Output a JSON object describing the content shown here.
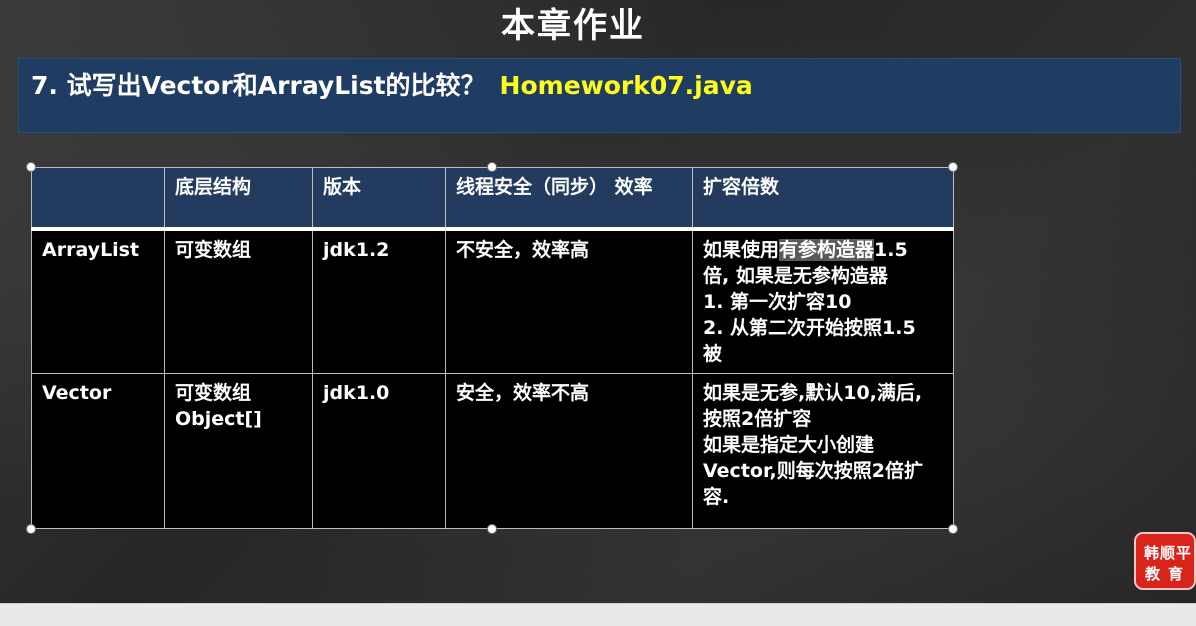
{
  "chapter_title": "本章作业",
  "question": {
    "text": "7. 试写出Vector和ArrayList的比较？",
    "file": "Homework07.java"
  },
  "table": {
    "headers": [
      "",
      "底层结构",
      "版本",
      "线程安全（同步） 效率",
      "扩容倍数"
    ],
    "rows": [
      {
        "name": "ArrayList",
        "structure": [
          "可变数组"
        ],
        "version": "jdk1.2",
        "safety": "不安全，效率高",
        "growth_prefix": "如果使用",
        "growth_highlight": "有参构造器",
        "growth_rest": [
          "1.5",
          "倍, 如果是无参构造器",
          "1. 第一次扩容10",
          "2. 从第二次开始按照1.5",
          "被"
        ]
      },
      {
        "name": "Vector",
        "structure": [
          "可变数组",
          "Object[]"
        ],
        "version": "jdk1.0",
        "safety": "安全，效率不高",
        "growth": [
          "如果是无参,默认10,满后,",
          "按照2倍扩容",
          "如果是指定大小创建",
          "Vector,则每次按照2倍扩",
          "容."
        ]
      }
    ]
  },
  "logo": {
    "line1": "韩顺平",
    "line2": "教育"
  }
}
